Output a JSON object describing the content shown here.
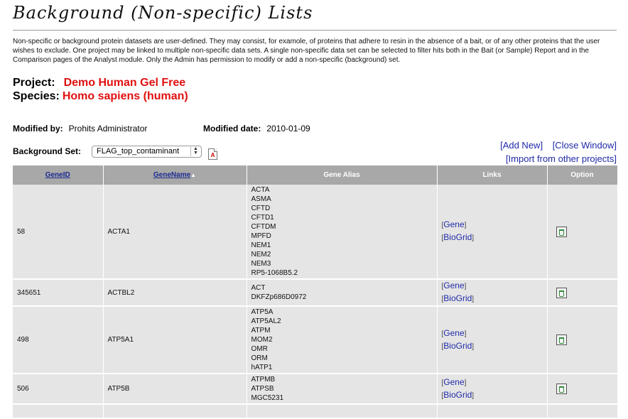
{
  "page": {
    "title": "Background (Non-specific) Lists",
    "description": "Non-specific or background protein datasets are user-defined. They may consist, for examole, of proteins that adhere to resin in the absence of a bait, or of any other proteins that the user wishes to exclude. One project may be linked to multiple non-specific data sets. A single non-specific data set can be selected to filter hits both in the Bait (or Sample) Report and in the Comparison pages of the Analyst module. Only the Admin has permission to modify or add a non-specific (background) set."
  },
  "project": {
    "project_label": "Project:",
    "project_value": "Demo Human Gel Free",
    "species_label": "Species:",
    "species_value": "Homo sapiens (human)"
  },
  "meta": {
    "modified_by_label": "Modified by:",
    "modified_by_value": "Prohits Administrator",
    "modified_date_label": "Modified date:",
    "modified_date_value": "2010-01-09"
  },
  "background": {
    "label": "Background Set:",
    "selected": "FLAG_top_contaminant",
    "pdf_icon": "pdf-icon"
  },
  "actions": {
    "add_new": "[Add New]",
    "close_window": "[Close Window]",
    "import": "[Import from other projects]"
  },
  "table": {
    "headers": {
      "gene_id": "GeneID",
      "gene_name": "GeneName",
      "gene_name_sort": "▲",
      "alias": "Gene Alias",
      "links": "Links",
      "option": "Option"
    },
    "link_gene": "Gene",
    "link_biogrid": "BioGrid",
    "rows": [
      {
        "gene_id": "58",
        "gene_name": "ACTA1",
        "aliases": [
          "ACTA",
          "ASMA",
          "CFTD",
          "CFTD1",
          "CFTDM",
          "MPFD",
          "NEM1",
          "NEM2",
          "NEM3",
          "RP5-1068B5.2"
        ]
      },
      {
        "gene_id": "345651",
        "gene_name": "ACTBL2",
        "aliases": [
          "ACT",
          "DKFZp686D0972"
        ]
      },
      {
        "gene_id": "498",
        "gene_name": "ATP5A1",
        "aliases": [
          "ATP5A",
          "ATP5AL2",
          "ATPM",
          "MOM2",
          "OMR",
          "ORM",
          "hATP1"
        ]
      },
      {
        "gene_id": "506",
        "gene_name": "ATP5B",
        "aliases": [
          "ATPMB",
          "ATPSB",
          "MGC5231"
        ]
      },
      {
        "gene_id": "",
        "gene_name": "",
        "aliases": [
          ""
        ]
      }
    ]
  }
}
